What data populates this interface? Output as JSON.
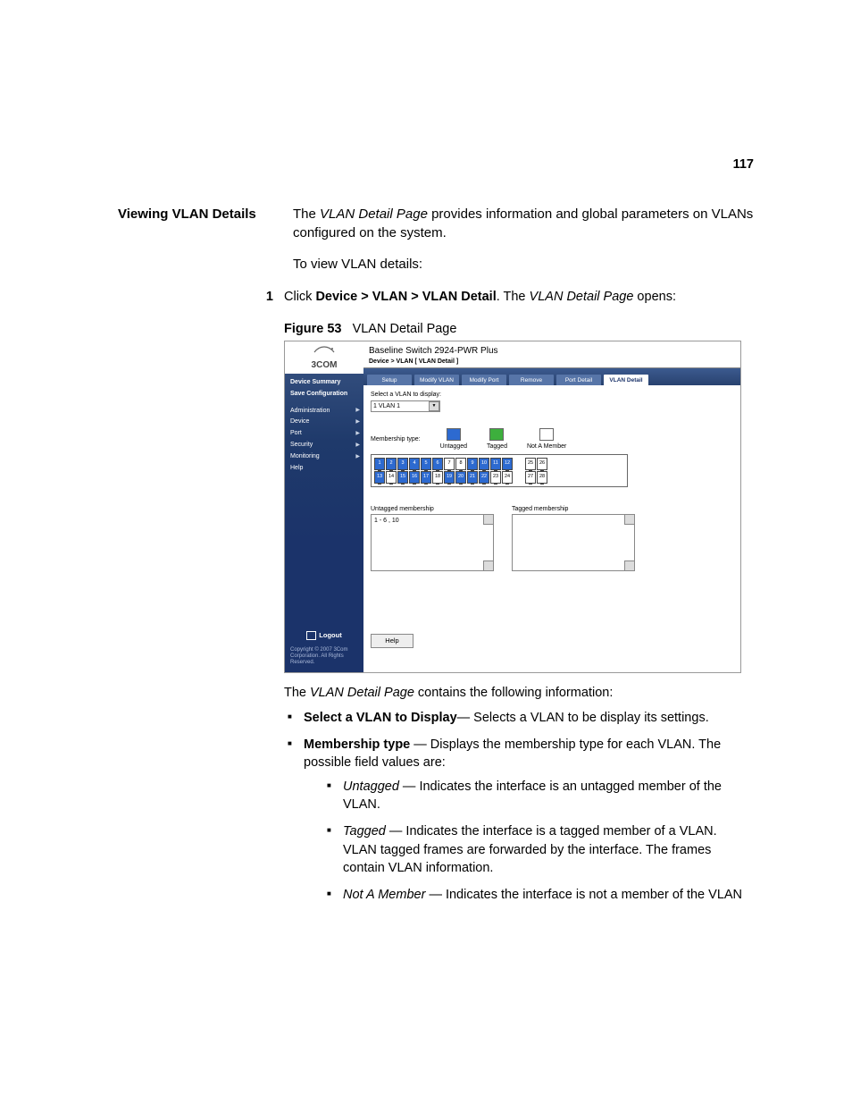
{
  "page_number": "117",
  "section_heading": "Viewing VLAN Details",
  "intro": {
    "sentence1_part1": "The ",
    "sentence1_em": "VLAN Detail Page",
    "sentence1_part2": " provides information and global parameters on VLANs configured on the system.",
    "sentence2": "To view VLAN details:"
  },
  "step": {
    "number": "1",
    "part1": "Click ",
    "bold": "Device > VLAN > VLAN Detail",
    "part2": ". The ",
    "em": "VLAN Detail Page",
    "part3": " opens:"
  },
  "figure": {
    "label": "Figure 53",
    "caption": "VLAN Detail Page"
  },
  "screenshot": {
    "logo_text": "3COM",
    "product_title": "Baseline Switch 2924-PWR Plus",
    "breadcrumb": "Device > VLAN [ VLAN Detail ]",
    "sidebar": {
      "top_links": [
        "Device Summary",
        "Save Configuration"
      ],
      "items": [
        "Administration",
        "Device",
        "Port",
        "Security",
        "Monitoring",
        "Help"
      ],
      "logout": "Logout",
      "copyright": "Copyright © 2007 3Com Corporation. All Rights Reserved."
    },
    "tabs": [
      "Setup",
      "Modify VLAN",
      "Modify Port",
      "Remove",
      "Port Detail",
      "VLAN Detail"
    ],
    "active_tab_index": 5,
    "select_label": "Select a VLAN to display:",
    "select_value": "1    VLAN 1",
    "membership_type_label": "Membership type:",
    "legend": {
      "untagged": "Untagged",
      "tagged": "Tagged",
      "not_member": "Not A Member"
    },
    "ports": {
      "row1": [
        {
          "n": "1",
          "s": "u"
        },
        {
          "n": "2",
          "s": "u"
        },
        {
          "n": "3",
          "s": "u"
        },
        {
          "n": "4",
          "s": "u"
        },
        {
          "n": "5",
          "s": "u"
        },
        {
          "n": "6",
          "s": "u"
        },
        {
          "n": "7",
          "s": "n"
        },
        {
          "n": "8",
          "s": "n"
        },
        {
          "n": "9",
          "s": "u"
        },
        {
          "n": "10",
          "s": "u"
        },
        {
          "n": "11",
          "s": "u"
        },
        {
          "n": "12",
          "s": "u"
        }
      ],
      "row2": [
        {
          "n": "13",
          "s": "u"
        },
        {
          "n": "14",
          "s": "n"
        },
        {
          "n": "15",
          "s": "u"
        },
        {
          "n": "16",
          "s": "u"
        },
        {
          "n": "17",
          "s": "u"
        },
        {
          "n": "18",
          "s": "n"
        },
        {
          "n": "19",
          "s": "u"
        },
        {
          "n": "20",
          "s": "u"
        },
        {
          "n": "21",
          "s": "u"
        },
        {
          "n": "22",
          "s": "u"
        },
        {
          "n": "23",
          "s": "n"
        },
        {
          "n": "24",
          "s": "n"
        }
      ],
      "extra": [
        {
          "n": "25",
          "s": "n"
        },
        {
          "n": "26",
          "s": "n"
        },
        {
          "n": "27",
          "s": "n"
        },
        {
          "n": "28",
          "s": "n"
        }
      ]
    },
    "untagged_membership_label": "Untagged membership",
    "untagged_membership_value": "1 - 6 , 10",
    "tagged_membership_label": "Tagged membership",
    "tagged_membership_value": "",
    "help_button": "Help"
  },
  "post_figure": {
    "sentence_part1": "The ",
    "sentence_em": "VLAN Detail Page",
    "sentence_part2": " contains the following information:"
  },
  "bullets": {
    "b1_bold": "Select a VLAN to Display",
    "b1_rest": "— Selects a VLAN to be display its settings.",
    "b2_bold": "Membership type ",
    "b2_rest": "— Displays the membership type for each VLAN. The possible field values are:",
    "sub": {
      "s1_em": "Untagged ",
      "s1_rest": "— Indicates the interface is an untagged member of the VLAN.",
      "s2_em": "Tagged ",
      "s2_rest": "— Indicates the interface is a tagged member of a VLAN. VLAN tagged frames are forwarded by the interface. The frames contain VLAN information.",
      "s3_em": "Not A Member ",
      "s3_rest": "— Indicates the interface is not a member of the VLAN"
    }
  }
}
